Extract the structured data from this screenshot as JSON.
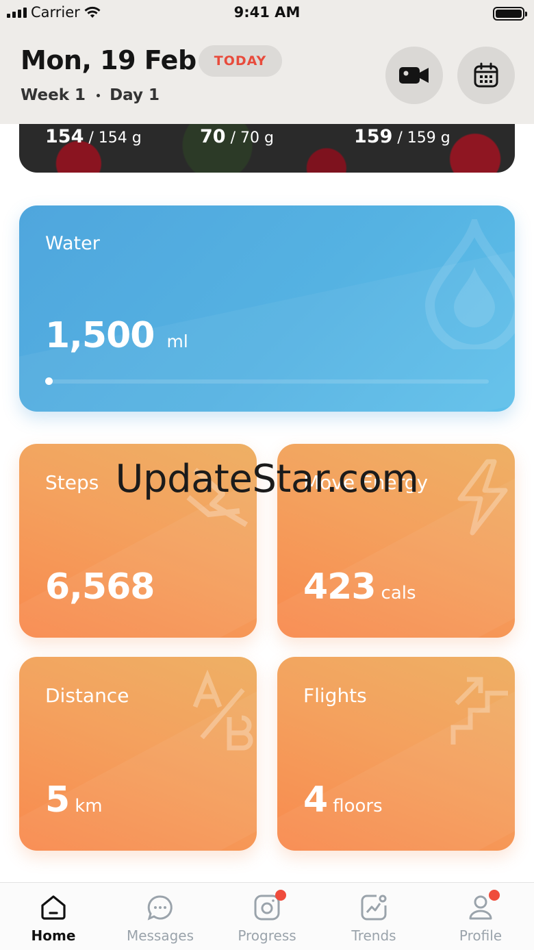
{
  "status_bar": {
    "carrier": "Carrier",
    "time": "9:41 AM"
  },
  "header": {
    "date": "Mon, 19 Feb",
    "today_label": "TODAY",
    "week": "Week 1",
    "day": "Day 1"
  },
  "macros": [
    {
      "consumed": "154",
      "target": "/ 154 g"
    },
    {
      "consumed": "70",
      "target": "/ 70 g"
    },
    {
      "consumed": "159",
      "target": "/ 159 g"
    }
  ],
  "water": {
    "title": "Water",
    "value": "1,500",
    "unit": "ml",
    "progress": 0.0
  },
  "tiles": {
    "steps": {
      "label": "Steps",
      "value": "6,568",
      "unit": ""
    },
    "move_energy": {
      "label": "Move Energy",
      "value": "423",
      "unit": "cals"
    },
    "distance": {
      "label": "Distance",
      "value": "5",
      "unit": "km"
    },
    "flights": {
      "label": "Flights",
      "value": "4",
      "unit": "floors"
    }
  },
  "watermark": "UpdateStar.com",
  "tabbar": [
    {
      "label": "Home",
      "icon": "home-icon",
      "active": true,
      "badge": false
    },
    {
      "label": "Messages",
      "icon": "chat-icon",
      "active": false,
      "badge": false
    },
    {
      "label": "Progress",
      "icon": "camera-icon",
      "active": false,
      "badge": true
    },
    {
      "label": "Trends",
      "icon": "trend-chart-icon",
      "active": false,
      "badge": false
    },
    {
      "label": "Profile",
      "icon": "user-icon",
      "active": false,
      "badge": true
    }
  ],
  "colors": {
    "water_card": "#55b2e2",
    "tile_orange": "#f4a15e",
    "today_text": "#e84b3c",
    "badge": "#ef4c3c",
    "tab_inactive": "#9aa3ab"
  }
}
